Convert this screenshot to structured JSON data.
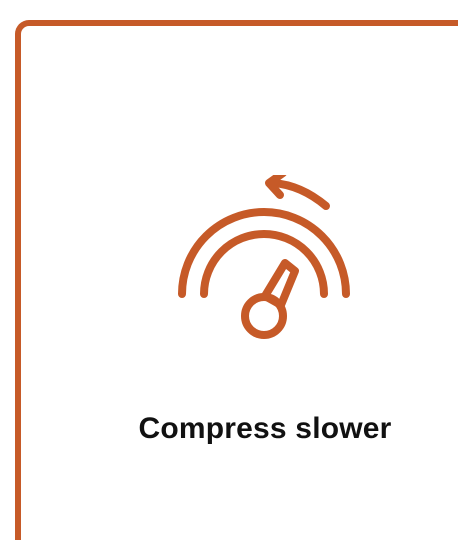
{
  "card": {
    "title": "Compress slower",
    "icon": "speedometer-slow-icon",
    "accent_color": "#c65a28"
  }
}
